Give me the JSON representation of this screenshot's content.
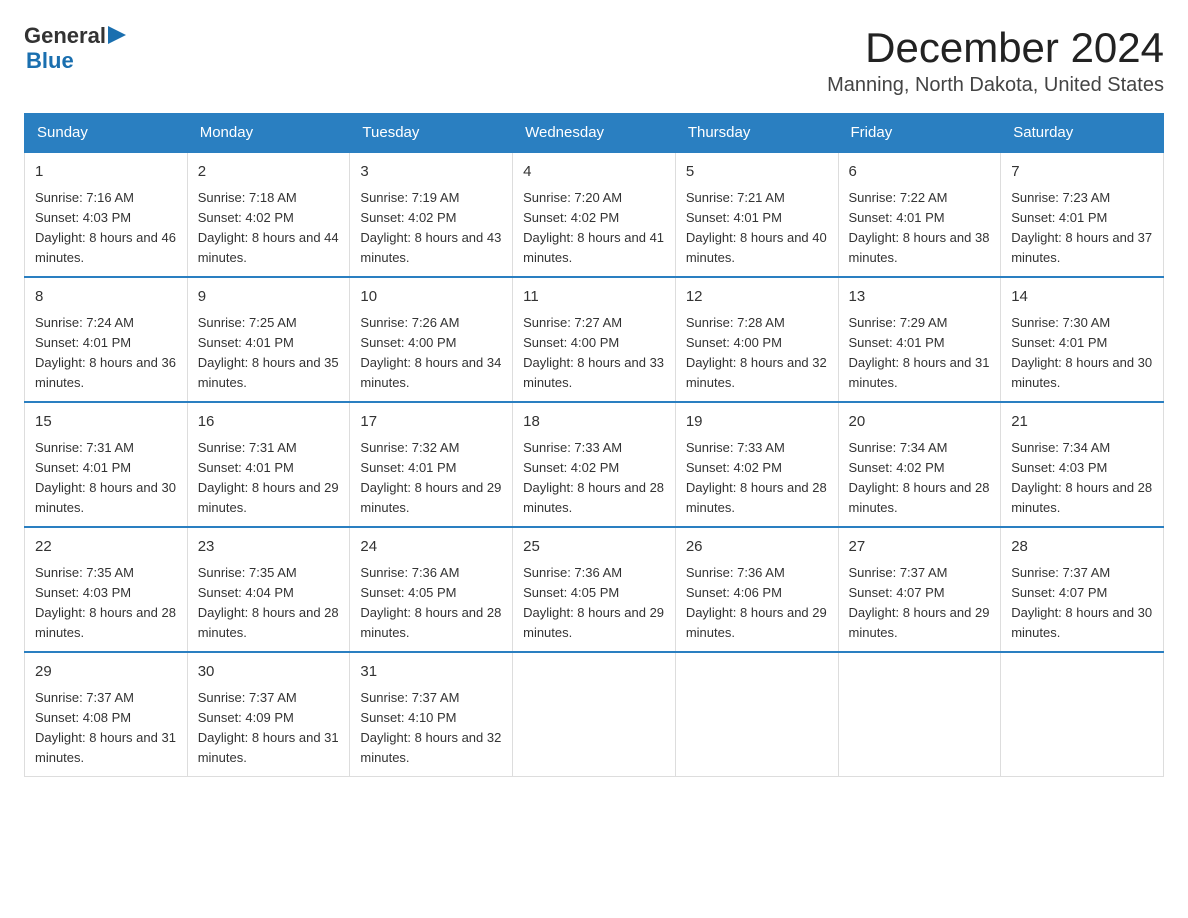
{
  "header": {
    "logo_text_general": "General",
    "logo_text_blue": "Blue",
    "title": "December 2024",
    "subtitle": "Manning, North Dakota, United States"
  },
  "days_of_week": [
    "Sunday",
    "Monday",
    "Tuesday",
    "Wednesday",
    "Thursday",
    "Friday",
    "Saturday"
  ],
  "weeks": [
    [
      {
        "day": "1",
        "sunrise": "7:16 AM",
        "sunset": "4:03 PM",
        "daylight": "8 hours and 46 minutes."
      },
      {
        "day": "2",
        "sunrise": "7:18 AM",
        "sunset": "4:02 PM",
        "daylight": "8 hours and 44 minutes."
      },
      {
        "day": "3",
        "sunrise": "7:19 AM",
        "sunset": "4:02 PM",
        "daylight": "8 hours and 43 minutes."
      },
      {
        "day": "4",
        "sunrise": "7:20 AM",
        "sunset": "4:02 PM",
        "daylight": "8 hours and 41 minutes."
      },
      {
        "day": "5",
        "sunrise": "7:21 AM",
        "sunset": "4:01 PM",
        "daylight": "8 hours and 40 minutes."
      },
      {
        "day": "6",
        "sunrise": "7:22 AM",
        "sunset": "4:01 PM",
        "daylight": "8 hours and 38 minutes."
      },
      {
        "day": "7",
        "sunrise": "7:23 AM",
        "sunset": "4:01 PM",
        "daylight": "8 hours and 37 minutes."
      }
    ],
    [
      {
        "day": "8",
        "sunrise": "7:24 AM",
        "sunset": "4:01 PM",
        "daylight": "8 hours and 36 minutes."
      },
      {
        "day": "9",
        "sunrise": "7:25 AM",
        "sunset": "4:01 PM",
        "daylight": "8 hours and 35 minutes."
      },
      {
        "day": "10",
        "sunrise": "7:26 AM",
        "sunset": "4:00 PM",
        "daylight": "8 hours and 34 minutes."
      },
      {
        "day": "11",
        "sunrise": "7:27 AM",
        "sunset": "4:00 PM",
        "daylight": "8 hours and 33 minutes."
      },
      {
        "day": "12",
        "sunrise": "7:28 AM",
        "sunset": "4:00 PM",
        "daylight": "8 hours and 32 minutes."
      },
      {
        "day": "13",
        "sunrise": "7:29 AM",
        "sunset": "4:01 PM",
        "daylight": "8 hours and 31 minutes."
      },
      {
        "day": "14",
        "sunrise": "7:30 AM",
        "sunset": "4:01 PM",
        "daylight": "8 hours and 30 minutes."
      }
    ],
    [
      {
        "day": "15",
        "sunrise": "7:31 AM",
        "sunset": "4:01 PM",
        "daylight": "8 hours and 30 minutes."
      },
      {
        "day": "16",
        "sunrise": "7:31 AM",
        "sunset": "4:01 PM",
        "daylight": "8 hours and 29 minutes."
      },
      {
        "day": "17",
        "sunrise": "7:32 AM",
        "sunset": "4:01 PM",
        "daylight": "8 hours and 29 minutes."
      },
      {
        "day": "18",
        "sunrise": "7:33 AM",
        "sunset": "4:02 PM",
        "daylight": "8 hours and 28 minutes."
      },
      {
        "day": "19",
        "sunrise": "7:33 AM",
        "sunset": "4:02 PM",
        "daylight": "8 hours and 28 minutes."
      },
      {
        "day": "20",
        "sunrise": "7:34 AM",
        "sunset": "4:02 PM",
        "daylight": "8 hours and 28 minutes."
      },
      {
        "day": "21",
        "sunrise": "7:34 AM",
        "sunset": "4:03 PM",
        "daylight": "8 hours and 28 minutes."
      }
    ],
    [
      {
        "day": "22",
        "sunrise": "7:35 AM",
        "sunset": "4:03 PM",
        "daylight": "8 hours and 28 minutes."
      },
      {
        "day": "23",
        "sunrise": "7:35 AM",
        "sunset": "4:04 PM",
        "daylight": "8 hours and 28 minutes."
      },
      {
        "day": "24",
        "sunrise": "7:36 AM",
        "sunset": "4:05 PM",
        "daylight": "8 hours and 28 minutes."
      },
      {
        "day": "25",
        "sunrise": "7:36 AM",
        "sunset": "4:05 PM",
        "daylight": "8 hours and 29 minutes."
      },
      {
        "day": "26",
        "sunrise": "7:36 AM",
        "sunset": "4:06 PM",
        "daylight": "8 hours and 29 minutes."
      },
      {
        "day": "27",
        "sunrise": "7:37 AM",
        "sunset": "4:07 PM",
        "daylight": "8 hours and 29 minutes."
      },
      {
        "day": "28",
        "sunrise": "7:37 AM",
        "sunset": "4:07 PM",
        "daylight": "8 hours and 30 minutes."
      }
    ],
    [
      {
        "day": "29",
        "sunrise": "7:37 AM",
        "sunset": "4:08 PM",
        "daylight": "8 hours and 31 minutes."
      },
      {
        "day": "30",
        "sunrise": "7:37 AM",
        "sunset": "4:09 PM",
        "daylight": "8 hours and 31 minutes."
      },
      {
        "day": "31",
        "sunrise": "7:37 AM",
        "sunset": "4:10 PM",
        "daylight": "8 hours and 32 minutes."
      },
      null,
      null,
      null,
      null
    ]
  ]
}
